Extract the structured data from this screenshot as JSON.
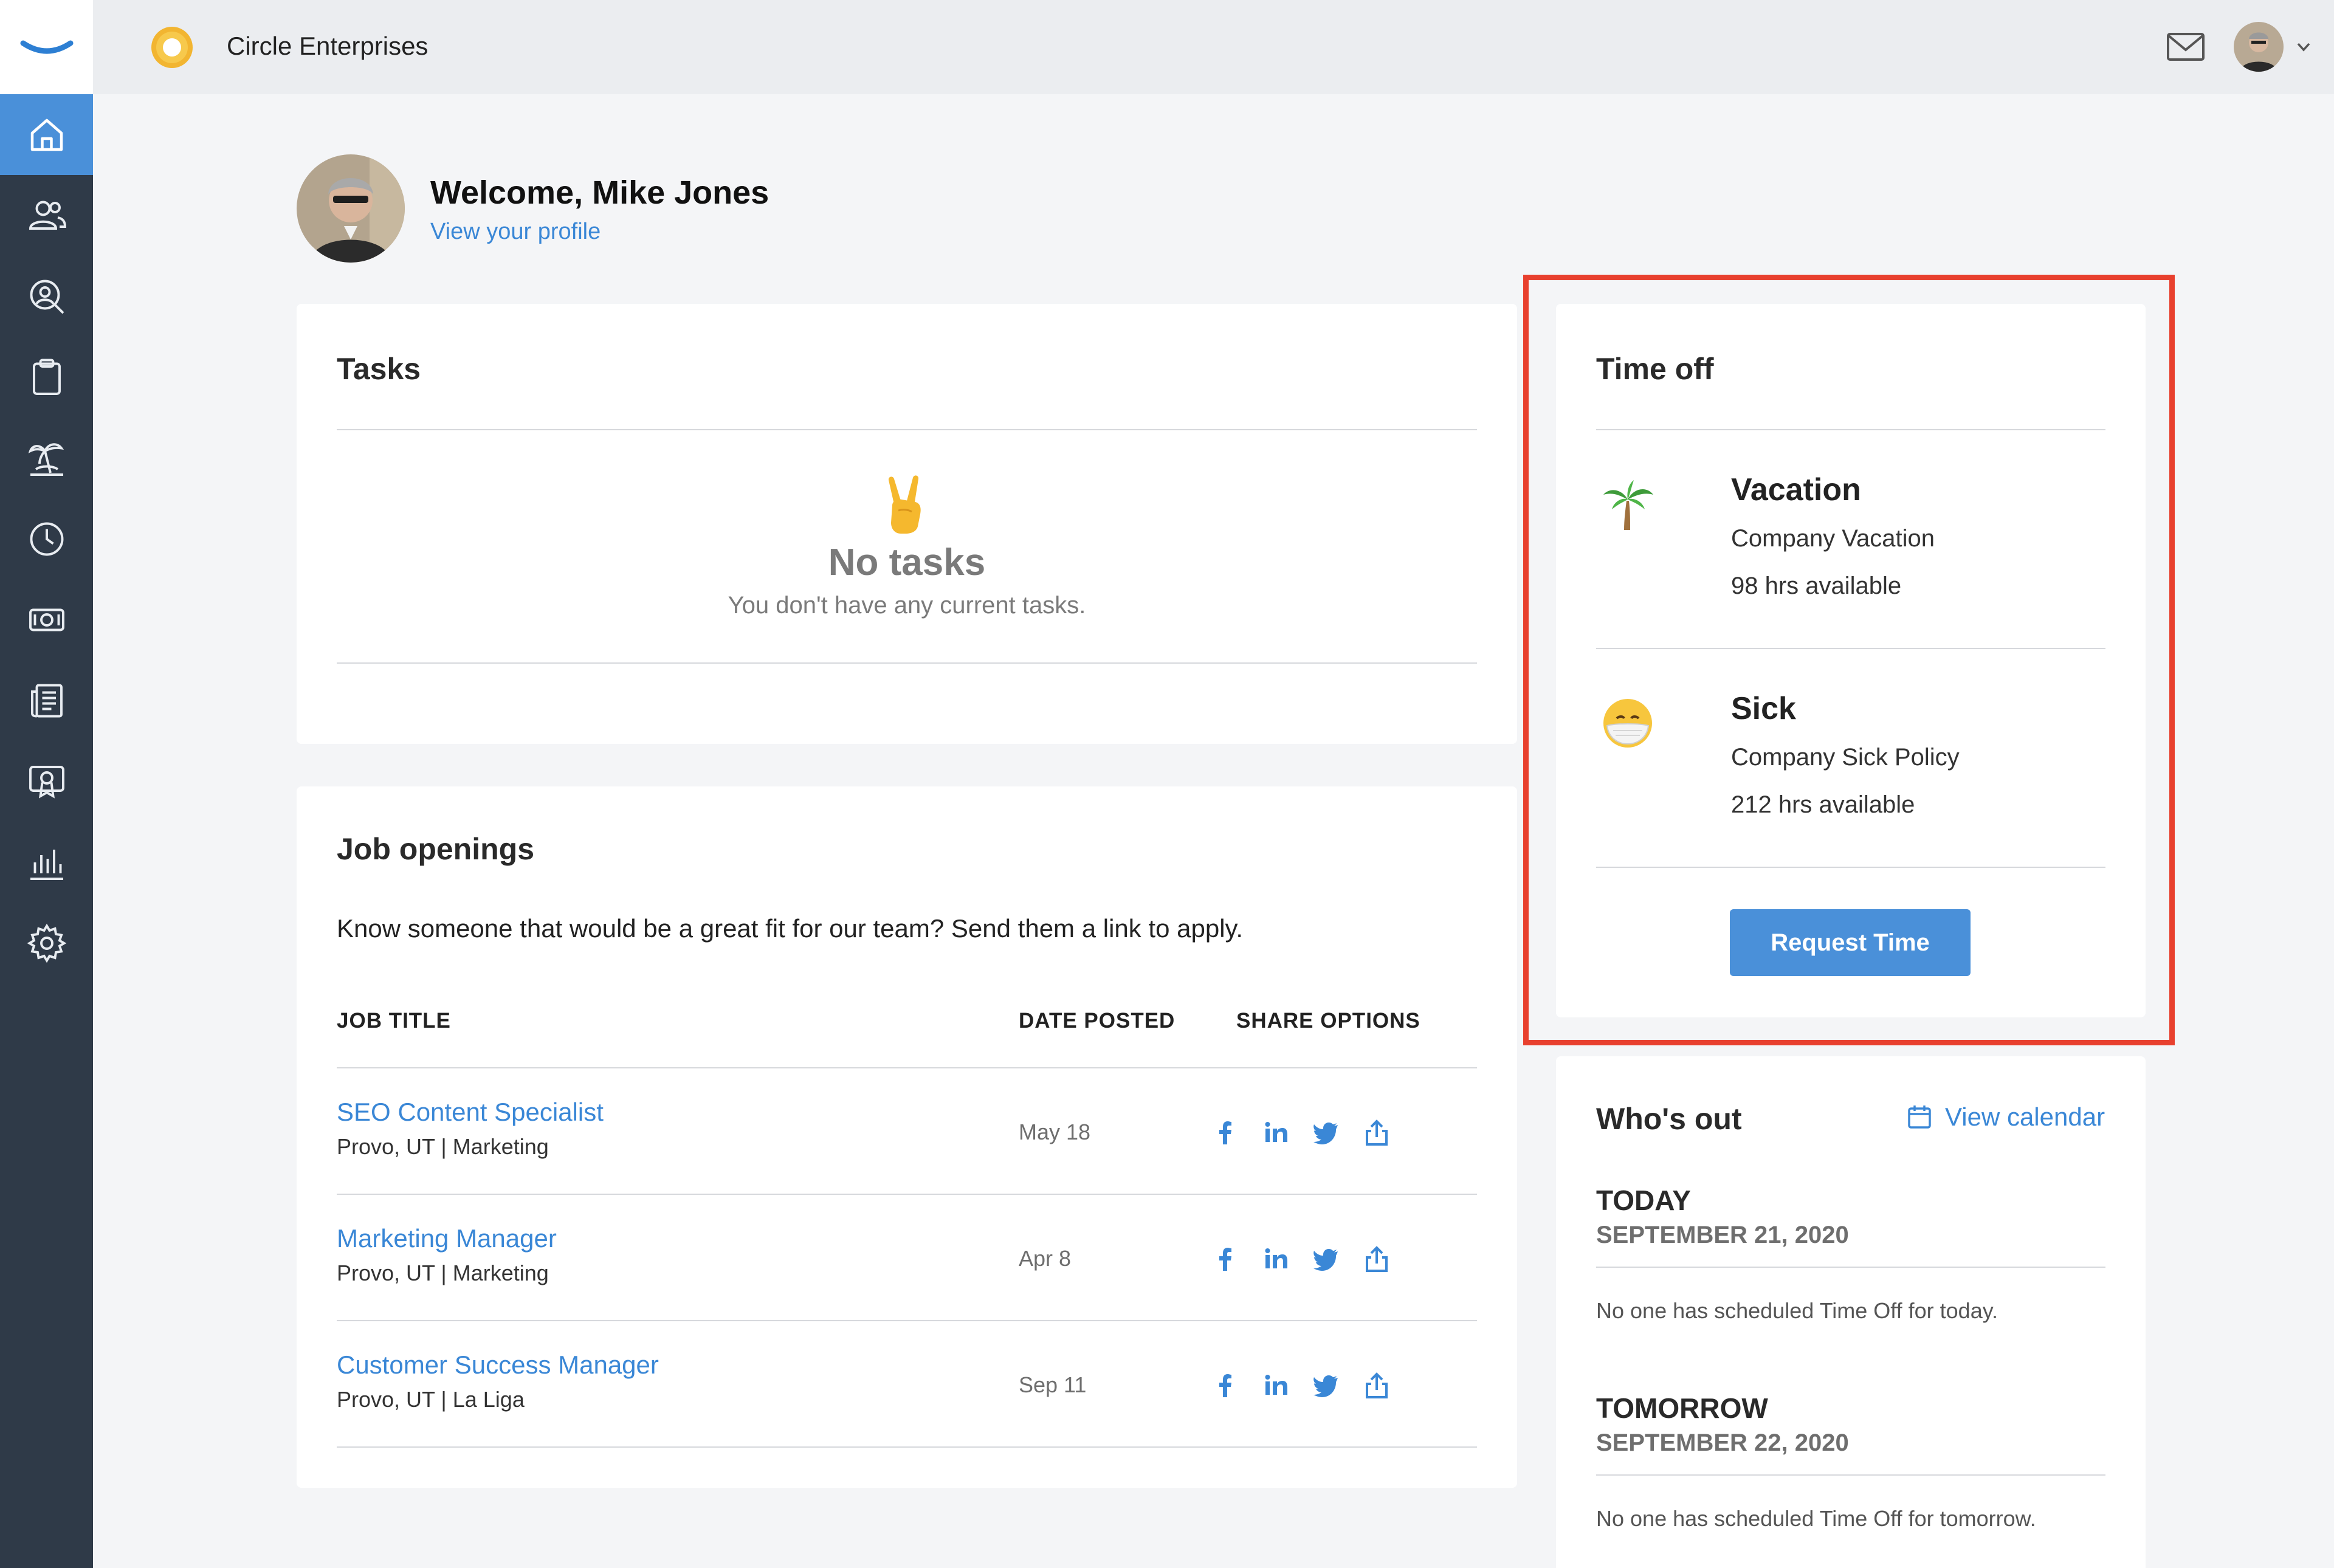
{
  "app": {
    "company_name": "Circle Enterprises",
    "accent_color": "#4a90d9",
    "highlight_color": "#e8402e"
  },
  "sidebar": {
    "items": [
      {
        "icon": "home-icon",
        "active": true
      },
      {
        "icon": "people-icon"
      },
      {
        "icon": "user-search-icon"
      },
      {
        "icon": "clipboard-icon"
      },
      {
        "icon": "palm-tree-icon"
      },
      {
        "icon": "clock-icon"
      },
      {
        "icon": "money-icon"
      },
      {
        "icon": "news-icon"
      },
      {
        "icon": "award-icon"
      },
      {
        "icon": "bar-chart-icon"
      },
      {
        "icon": "gear-icon"
      }
    ]
  },
  "welcome": {
    "title": "Welcome, Mike Jones",
    "profile_link": "View your profile"
  },
  "tasks": {
    "title": "Tasks",
    "empty_emoji": "victory-hand-icon",
    "empty_title": "No tasks",
    "empty_subtitle": "You don't have any current tasks."
  },
  "jobs": {
    "title": "Job openings",
    "intro": "Know someone that would be a great fit for our team? Send them a link to apply.",
    "columns": [
      "JOB TITLE",
      "DATE POSTED",
      "SHARE OPTIONS"
    ],
    "rows": [
      {
        "title": "SEO Content Specialist",
        "meta": "Provo, UT | Marketing",
        "date": "May 18"
      },
      {
        "title": "Marketing Manager",
        "meta": "Provo, UT | Marketing",
        "date": "Apr 8"
      },
      {
        "title": "Customer Success Manager",
        "meta": "Provo, UT | La Liga",
        "date": "Sep 11"
      }
    ],
    "share_icons": [
      "facebook-icon",
      "linkedin-icon",
      "twitter-icon",
      "share-icon"
    ]
  },
  "time_off": {
    "title": "Time off",
    "policies": [
      {
        "icon": "palm-tree-emoji-icon",
        "name": "Vacation",
        "policy": "Company Vacation",
        "hours": "98 hrs available"
      },
      {
        "icon": "mask-face-emoji-icon",
        "name": "Sick",
        "policy": "Company Sick Policy",
        "hours": "212 hrs available"
      }
    ],
    "request_label": "Request Time"
  },
  "whos_out": {
    "title": "Who's out",
    "calendar_link": "View calendar",
    "days": [
      {
        "label": "TODAY",
        "date": "SEPTEMBER 21, 2020",
        "note": "No one has scheduled Time Off for today."
      },
      {
        "label": "TOMORROW",
        "date": "SEPTEMBER 22, 2020",
        "note": "No one has scheduled Time Off for tomorrow."
      }
    ]
  }
}
